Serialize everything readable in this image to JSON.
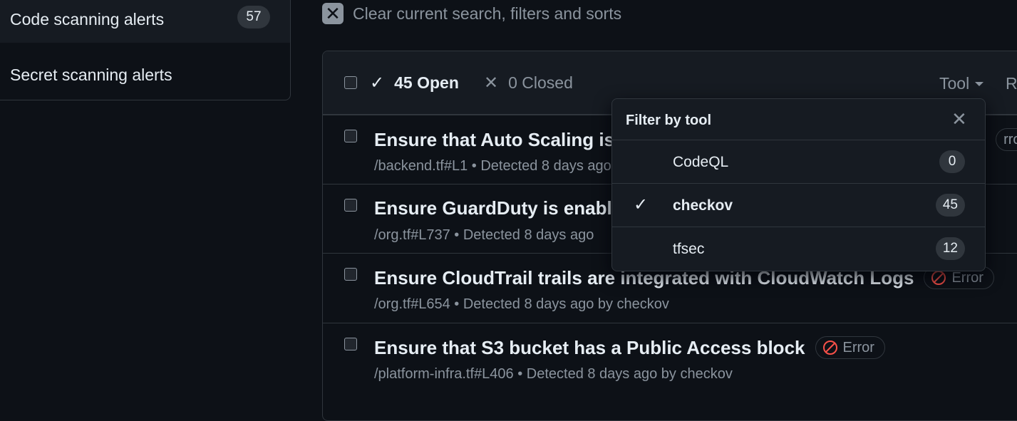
{
  "sidebar": {
    "items": [
      {
        "label": "Code scanning alerts",
        "count": "57"
      },
      {
        "label": "Secret scanning alerts"
      }
    ]
  },
  "clear_search": {
    "label": "Clear current search, filters and sorts",
    "icon": "close-icon"
  },
  "alerts_header": {
    "open_label": "45 Open",
    "closed_label": "0 Closed",
    "tool_label": "Tool",
    "next_label": "R"
  },
  "alerts": [
    {
      "title": "Ensure that Auto Scaling is",
      "meta": "/backend.tf#L1 • Detected 8 days ago",
      "severity": "rror"
    },
    {
      "title": "Ensure GuardDuty is enabl",
      "meta": "/org.tf#L737 • Detected 8 days ago"
    },
    {
      "title": "Ensure CloudTrail trails are integrated with CloudWatch Logs",
      "meta": "/org.tf#L654 • Detected 8 days ago by checkov",
      "severity": "Error"
    },
    {
      "title": "Ensure that S3 bucket has a Public Access block",
      "meta": "/platform-infra.tf#L406 • Detected 8 days ago by checkov",
      "severity": "Error"
    }
  ],
  "tool_filter": {
    "title": "Filter by tool",
    "options": [
      {
        "label": "CodeQL",
        "count": "0",
        "selected": false
      },
      {
        "label": "checkov",
        "count": "45",
        "selected": true
      },
      {
        "label": "tfsec",
        "count": "12",
        "selected": false
      }
    ]
  },
  "colors": {
    "background": "#0d1117",
    "surface": "#161b22",
    "border": "#30363d",
    "error": "#f85149",
    "muted": "#8b949e"
  }
}
